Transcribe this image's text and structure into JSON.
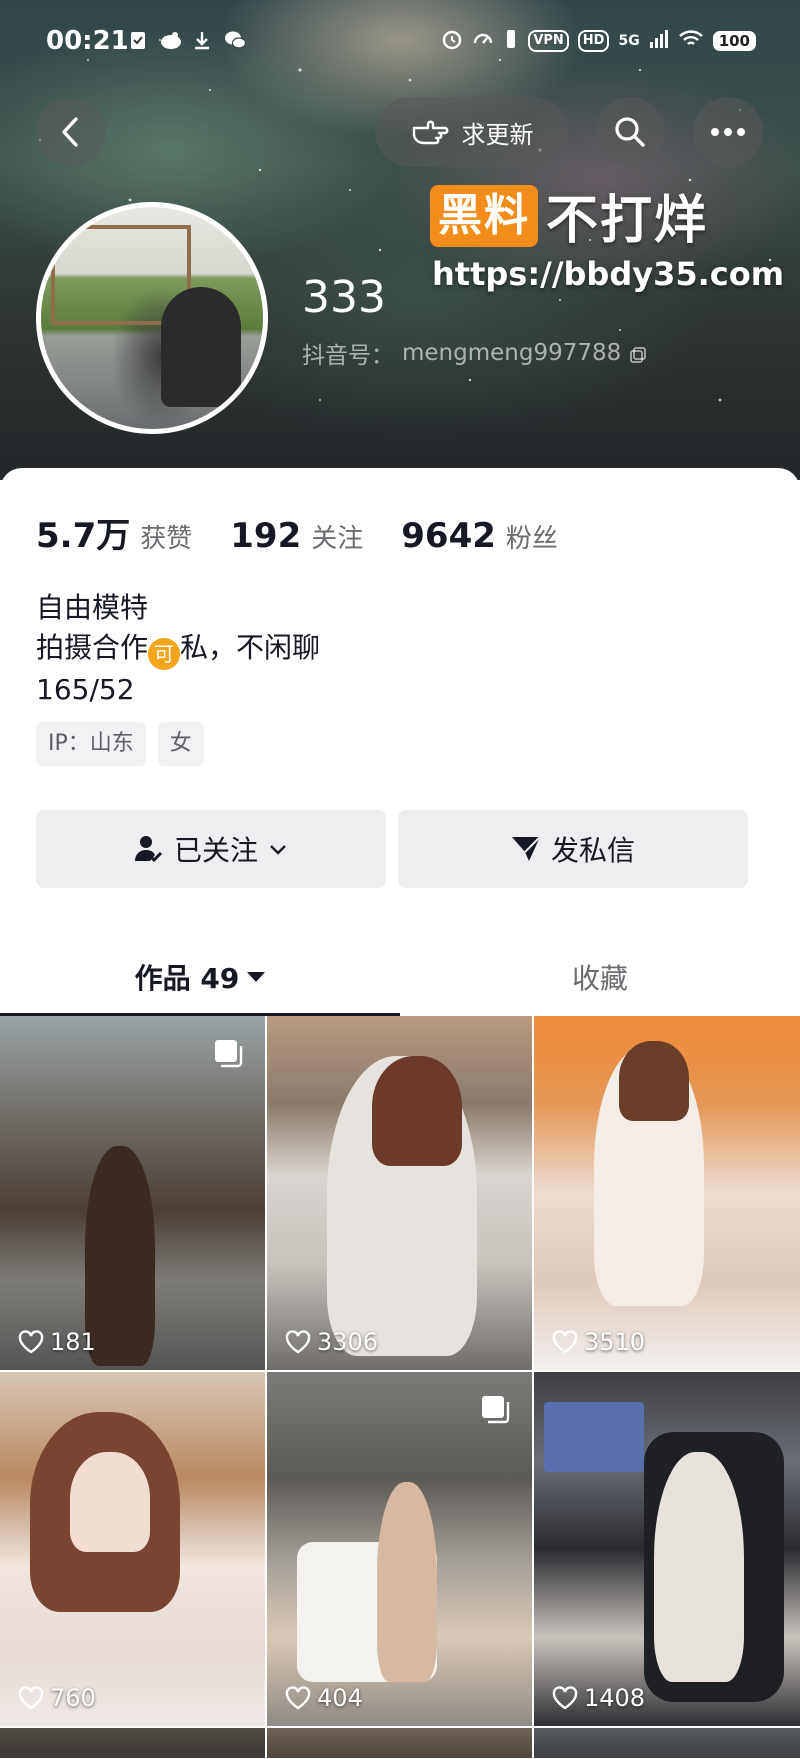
{
  "status_bar": {
    "time": "00:21",
    "network": "5G",
    "vpn": "VPN",
    "hd": "HD",
    "battery": "100"
  },
  "header": {
    "update_label": "求更新"
  },
  "watermark": {
    "badge": "黑料",
    "text": "不打烊",
    "url": "https://bbdy35.com"
  },
  "profile": {
    "name": "333",
    "douyin_id_label": "抖音号：",
    "douyin_id": "mengmeng997788"
  },
  "stats": [
    {
      "value": "5.7万",
      "label": "获赞"
    },
    {
      "value": "192",
      "label": "关注"
    },
    {
      "value": "9642",
      "label": "粉丝"
    }
  ],
  "bio": {
    "line1": "自由模特",
    "line2_prefix": "拍摄合作",
    "line2_badge": "可",
    "line2_suffix": "私，不闲聊",
    "line3": "165/52"
  },
  "tags": [
    "IP：山东",
    "女"
  ],
  "actions": {
    "follow": "已关注",
    "message": "发私信"
  },
  "tabs": {
    "works": "作品 49",
    "favorites": "收藏"
  },
  "posts": [
    {
      "likes": "181",
      "multi": true
    },
    {
      "likes": "3306",
      "multi": false
    },
    {
      "likes": "3510",
      "multi": false
    },
    {
      "likes": "760",
      "multi": false
    },
    {
      "likes": "404",
      "multi": true
    },
    {
      "likes": "1408",
      "multi": false
    }
  ],
  "colors": {
    "accent_orange": "#f28d1b",
    "text_primary": "#161823",
    "text_secondary": "#6b6c70"
  }
}
